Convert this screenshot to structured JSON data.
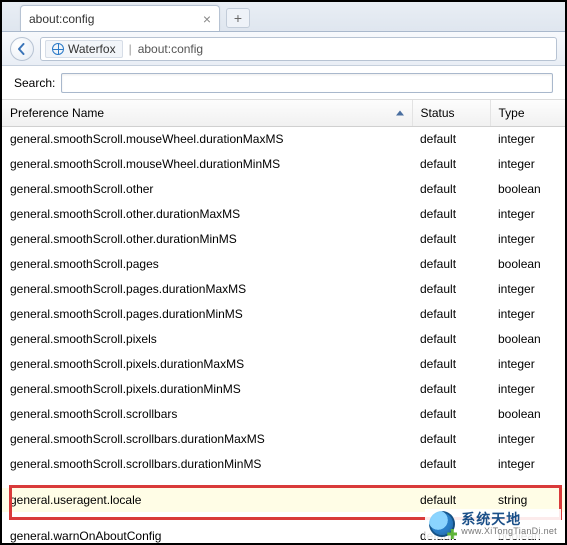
{
  "tab": {
    "title": "about:config"
  },
  "nav": {
    "site_name": "Waterfox",
    "url_path": "about:config"
  },
  "search": {
    "label": "Search:",
    "value": ""
  },
  "columns": {
    "name": "Preference Name",
    "status": "Status",
    "type": "Type"
  },
  "rows": [
    {
      "name": "general.smoothScroll.mouseWheel.durationMaxMS",
      "status": "default",
      "type": "integer"
    },
    {
      "name": "general.smoothScroll.mouseWheel.durationMinMS",
      "status": "default",
      "type": "integer"
    },
    {
      "name": "general.smoothScroll.other",
      "status": "default",
      "type": "boolean"
    },
    {
      "name": "general.smoothScroll.other.durationMaxMS",
      "status": "default",
      "type": "integer"
    },
    {
      "name": "general.smoothScroll.other.durationMinMS",
      "status": "default",
      "type": "integer"
    },
    {
      "name": "general.smoothScroll.pages",
      "status": "default",
      "type": "boolean"
    },
    {
      "name": "general.smoothScroll.pages.durationMaxMS",
      "status": "default",
      "type": "integer"
    },
    {
      "name": "general.smoothScroll.pages.durationMinMS",
      "status": "default",
      "type": "integer"
    },
    {
      "name": "general.smoothScroll.pixels",
      "status": "default",
      "type": "boolean"
    },
    {
      "name": "general.smoothScroll.pixels.durationMaxMS",
      "status": "default",
      "type": "integer"
    },
    {
      "name": "general.smoothScroll.pixels.durationMinMS",
      "status": "default",
      "type": "integer"
    },
    {
      "name": "general.smoothScroll.scrollbars",
      "status": "default",
      "type": "boolean"
    },
    {
      "name": "general.smoothScroll.scrollbars.durationMaxMS",
      "status": "default",
      "type": "integer"
    },
    {
      "name": "general.smoothScroll.scrollbars.durationMinMS",
      "status": "default",
      "type": "integer"
    },
    {
      "name": "",
      "status": "",
      "type": ""
    },
    {
      "name": "general.useragent.locale",
      "status": "default",
      "type": "string",
      "highlight": true
    },
    {
      "name": "",
      "status": "",
      "type": ""
    },
    {
      "name": "general.warnOnAboutConfig",
      "status": "default",
      "type": "boolean"
    }
  ],
  "watermark": {
    "title_cn": "系统天地",
    "url_text": "www.XiTongTianDi.net"
  }
}
